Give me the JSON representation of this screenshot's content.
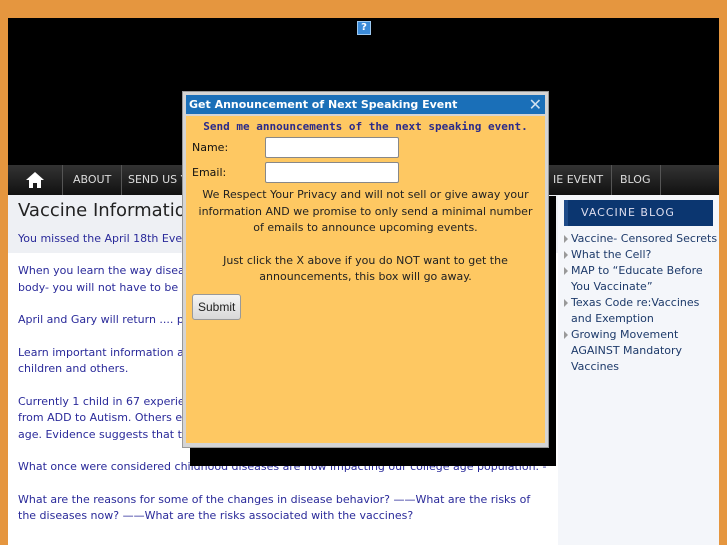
{
  "header": {
    "help_icon": "question-icon"
  },
  "nav": {
    "items": [
      "ABOUT",
      "SEND US YO",
      "IE EVENT",
      "BLOG"
    ]
  },
  "main": {
    "title": "Vaccine Information",
    "missed": "You missed the April 18th Event -",
    "paragraphs": [
      "When you learn the way disease\nbody-  you will not have to be afra",
      "April and Gary will return .... plea",
      "Learn important information abou\nchildren and others.",
      "Currently 1 child in 67 experience\nfrom ADD to Autism. Others exper\nage.  Evidence suggests that the",
      "What once were considered childhood diseases are now impacting our college age population.  -",
      "What are the reasons for some of the changes in disease behavior?   ——What are the risks of the diseases now?   ——What are the risks associated with the vaccines?"
    ]
  },
  "sidebar": {
    "heading": "VACCINE BLOG",
    "items": [
      "Vaccine- Censored Secrets",
      "What the Cell?",
      "MAP to “Educate Before You Vaccinate”",
      "Texas Code re:Vaccines and Exemption",
      "Growing Movement AGAINST Mandatory Vaccines"
    ]
  },
  "dialog": {
    "title": "Get Announcement of Next Speaking Event",
    "heading": "Send me announcements of the next speaking event.",
    "name_label": "Name:",
    "email_label": "Email:",
    "name_value": "",
    "email_value": "",
    "privacy": "We Respect Your Privacy and will not sell or give away your information  AND we promise to only send a minimal number of emails to announce upcoming events.",
    "instructions": "Just click the X above if you do NOT want to get the announcements, this box will go away.",
    "submit": "Submit"
  },
  "colors": {
    "background": "#e5963f",
    "dialog_title": "#1a6fb8",
    "dialog_body": "#fec862",
    "text_link": "#2a2a9a",
    "blog_heading": "#0b3670"
  }
}
